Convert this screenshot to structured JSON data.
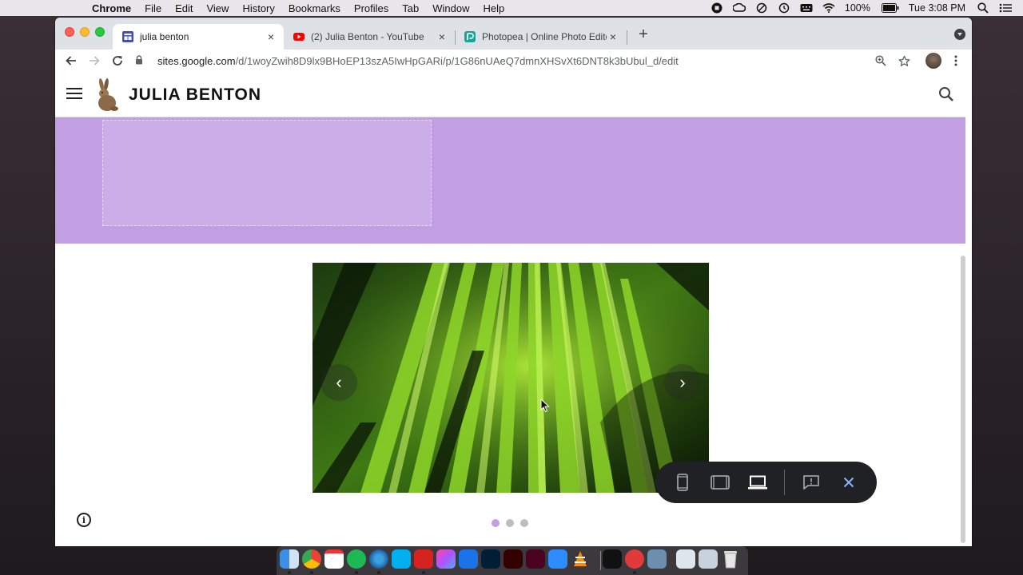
{
  "menubar": {
    "app_name": "Chrome",
    "menus": [
      "File",
      "Edit",
      "View",
      "History",
      "Bookmarks",
      "Profiles",
      "Tab",
      "Window",
      "Help"
    ],
    "battery": "100%",
    "clock": "Tue 3:08 PM"
  },
  "browser": {
    "tabs": [
      {
        "title": "julia benton",
        "active": true,
        "close": "×"
      },
      {
        "title": "(2) Julia Benton - YouTube",
        "active": false,
        "close": "×"
      },
      {
        "title": "Photopea | Online Photo Editor",
        "active": false,
        "close": "×"
      }
    ],
    "new_tab": "+",
    "url_host": "sites.google.com",
    "url_path": "/d/1woyZwih8D9lx9BHoEP13szA5IwHpGARi/p/1G86nUAeQ7dmnXHSvXt6DNT8k3bUbul_d/edit"
  },
  "site": {
    "title": "JULIA BENTON"
  },
  "carousel": {
    "prev": "‹",
    "next": "›",
    "slide_count": 3,
    "active_slide": 1
  },
  "colors": {
    "banner": "#c29ee3",
    "placeholder": "#cbade8",
    "dot_active": "#c29ee3",
    "preview_bar": "#202124",
    "close_accent": "#8ab4f8"
  },
  "icons": {
    "hamburger": "menu-icon",
    "search": "search-icon",
    "info": "info-icon",
    "preview_phone": "phone-preview-icon",
    "preview_tablet": "tablet-preview-icon",
    "preview_laptop": "laptop-preview-icon",
    "feedback": "feedback-icon",
    "close": "close-icon"
  }
}
